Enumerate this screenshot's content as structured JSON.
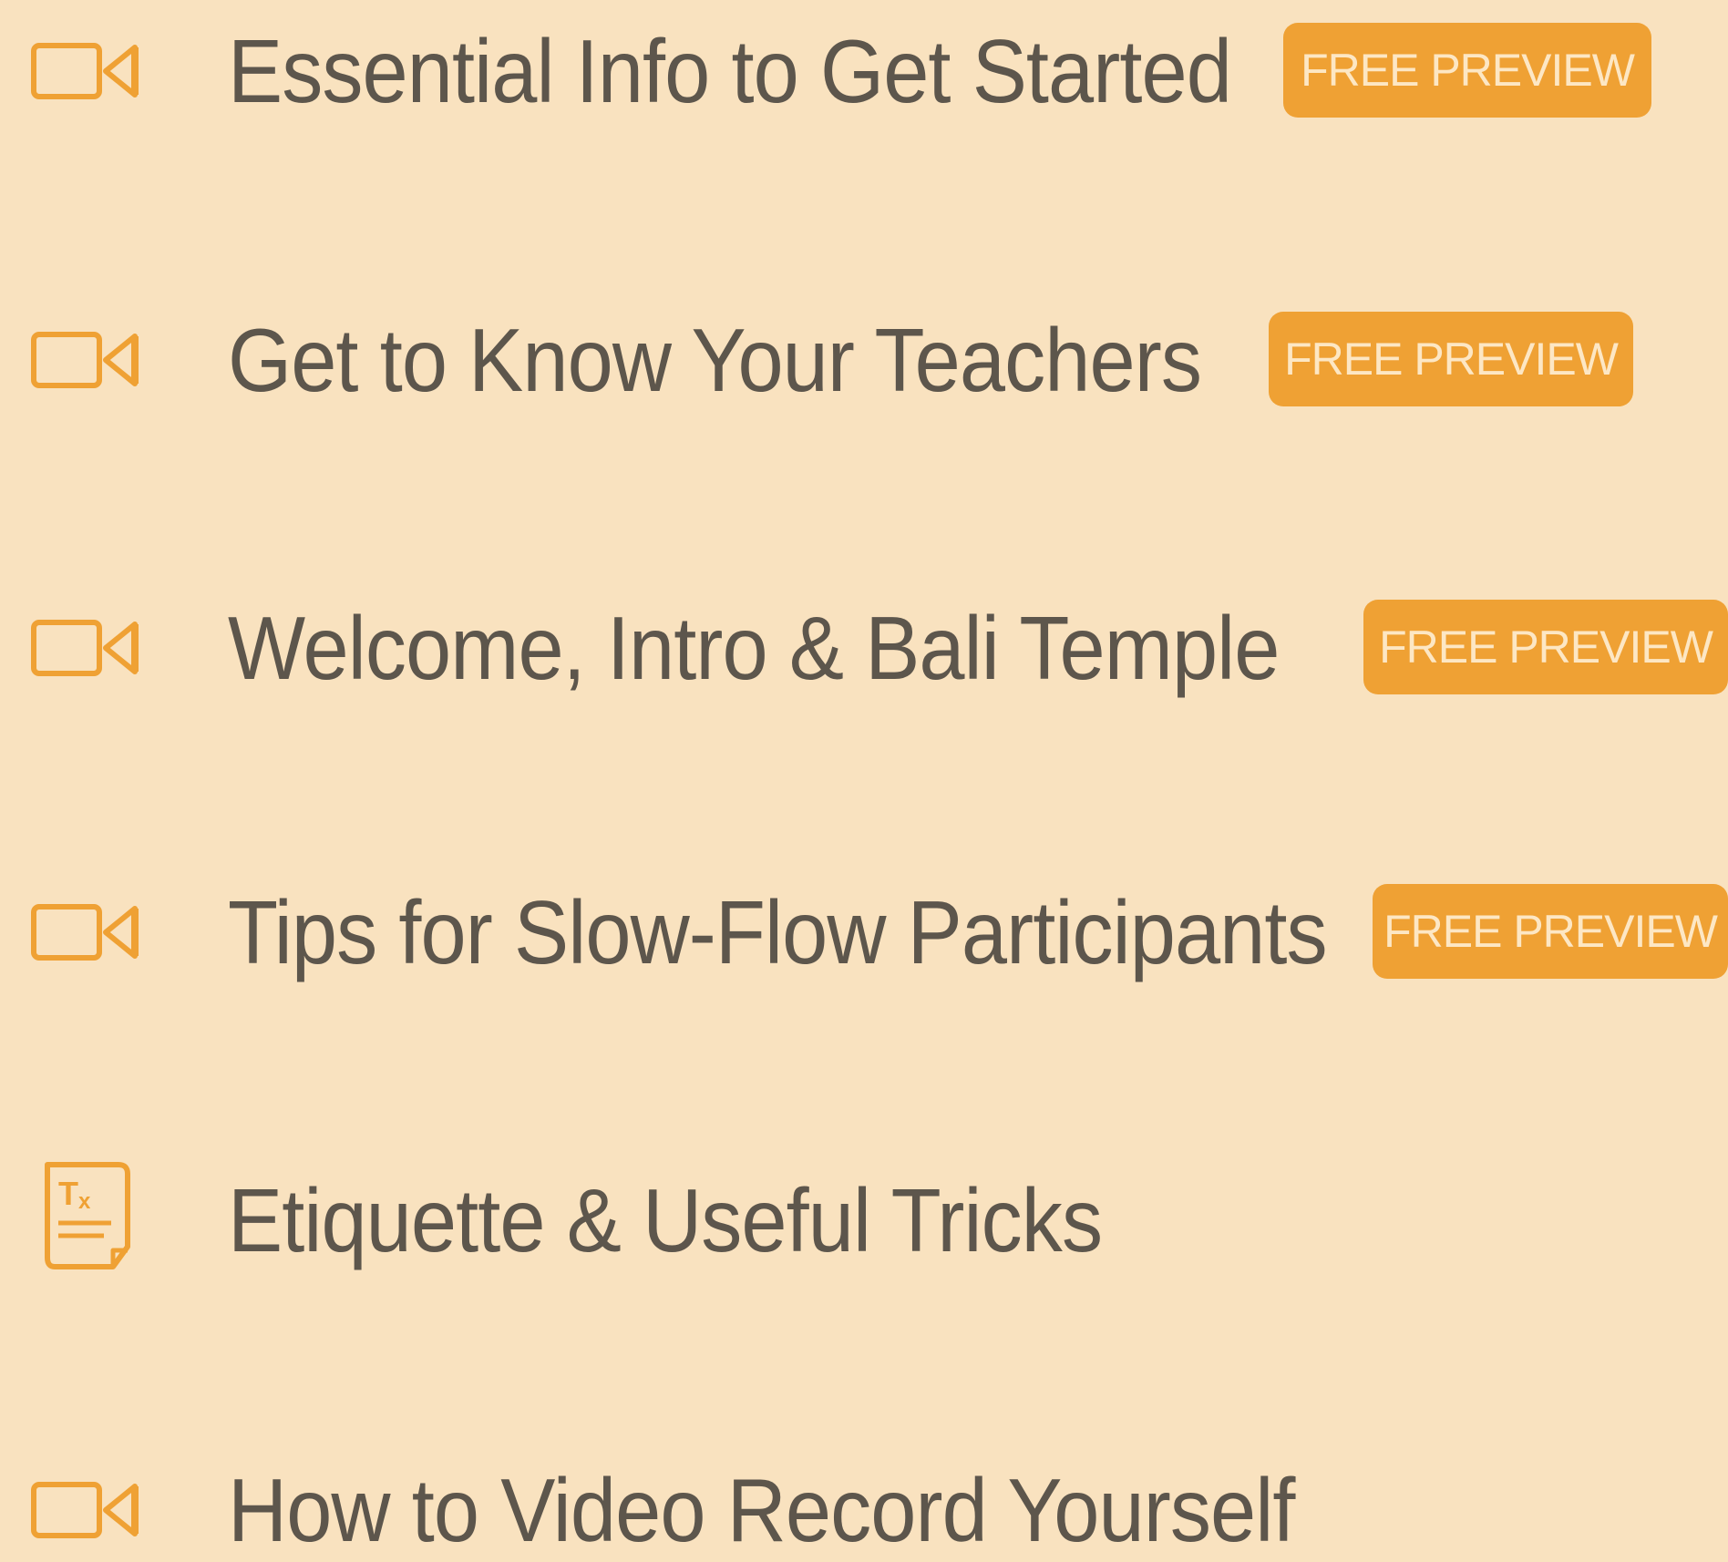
{
  "colors": {
    "background": "#f9e2bf",
    "accent": "#efa134",
    "title_text": "#5d564c",
    "badge_text": "#fde7c4"
  },
  "lessons": [
    {
      "title": "Essential Info to Get Started",
      "icon": "video-camera-icon",
      "badge": "FREE PREVIEW"
    },
    {
      "title": "Get to Know Your Teachers",
      "icon": "video-camera-icon",
      "badge": "FREE PREVIEW"
    },
    {
      "title": "Welcome, Intro & Bali Temple",
      "icon": "video-camera-icon",
      "badge": "FREE PREVIEW"
    },
    {
      "title": "Tips for Slow-Flow Participants",
      "icon": "video-camera-icon",
      "badge": "FREE PREVIEW"
    },
    {
      "title": "Etiquette & Useful Tricks",
      "icon": "text-document-icon"
    },
    {
      "title": "How to Video Record Yourself",
      "icon": "video-camera-icon"
    }
  ]
}
